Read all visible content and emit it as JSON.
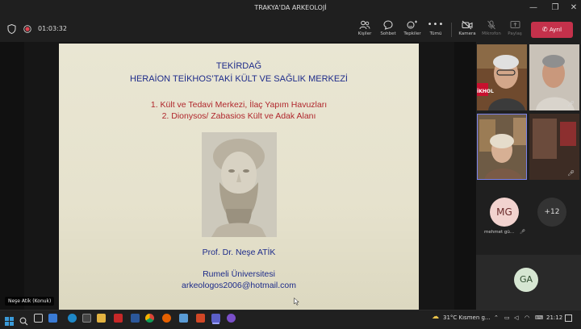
{
  "window": {
    "title": "TRAKYA'DA ARKEOLOJİ",
    "minimize": "—",
    "maximize": "❐",
    "close": "✕"
  },
  "toolbar": {
    "timer": "01:03:32",
    "people_label": "Kişiler",
    "chat_label": "Sohbet",
    "reactions_label": "Tepkiler",
    "more_label": "Tümü",
    "camera_label": "Kamera",
    "mic_label": "Mikrofon",
    "share_label": "Paylaş",
    "leave_label": "Ayrıl",
    "icons": {
      "shield": "shield-icon",
      "record": "record-icon",
      "people": "people-icon",
      "chat": "chat-icon",
      "reactions": "reactions-icon",
      "more": "more-icon",
      "camera": "camera-icon",
      "mic": "mic-off-icon",
      "share": "share-icon",
      "phone": "phone-icon"
    },
    "leave_color": "#c4314b"
  },
  "slide": {
    "title_line1": "TEKİRDAĞ",
    "title_line2": "HERAİON TEİKHOS’TAKİ KÜLT VE SAĞLIK MERKEZİ",
    "item1": "1. Kült ve Tedavi Merkezi, İlaç Yapım Havuzları",
    "item2": "2. Dionysos/ Zabasios Kült ve Adak Alanı",
    "author": "Prof. Dr. Neşe ATİK",
    "university": "Rumeli Üniversitesi",
    "email": "arkeologos2006@hotmail.com",
    "title_color": "#1d2b8a",
    "item_color": "#b0262c"
  },
  "presenter": {
    "name": "Neşe Atik (Konuk)"
  },
  "participants": {
    "tile1_badge": "İKHOL",
    "mg_initials": "MG",
    "mg_name": "mehmet gü...",
    "more_count": "+12",
    "ga_initials": "GA"
  },
  "taskbar": {
    "weather": "31°C  Kısmen g...",
    "time": "21:12",
    "icons": [
      "windows-icon",
      "search-icon",
      "taskview-icon",
      "widgets-icon",
      "edge-icon",
      "store-icon",
      "explorer-icon",
      "acrobat-icon",
      "word-icon",
      "chrome-icon",
      "firefox-icon",
      "paint-icon",
      "powerpoint-icon",
      "teams-icon",
      "settings-icon"
    ]
  }
}
